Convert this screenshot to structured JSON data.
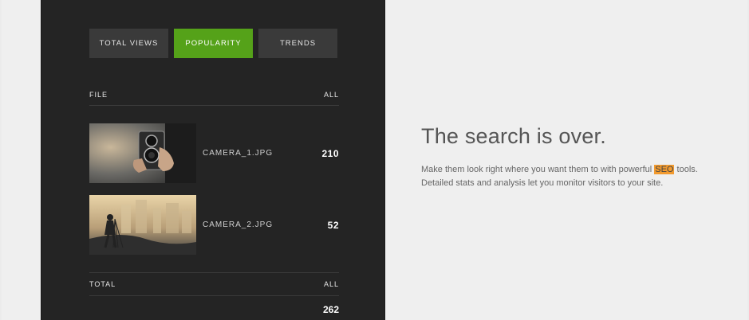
{
  "tabs": [
    {
      "label": "TOTAL VIEWS",
      "active": false
    },
    {
      "label": "POPULARITY",
      "active": true
    },
    {
      "label": "TRENDS",
      "active": false
    }
  ],
  "table": {
    "header": {
      "left": "FILE",
      "right": "ALL"
    },
    "rows": [
      {
        "name": "CAMERA_1.JPG",
        "value": "210"
      },
      {
        "name": "CAMERA_2.JPG",
        "value": "52"
      }
    ],
    "footer": {
      "left": "TOTAL",
      "right": "ALL"
    },
    "total": "262"
  },
  "hero": {
    "headline": "The search is over.",
    "body_before": "Make them look right where you want them to with powerful ",
    "highlight": "SEO",
    "body_after": " tools. Detailed stats and analysis let you monitor visitors to your site."
  },
  "colors": {
    "accent": "#55a219",
    "highlight": "#f29a2e",
    "panel": "#242424"
  }
}
